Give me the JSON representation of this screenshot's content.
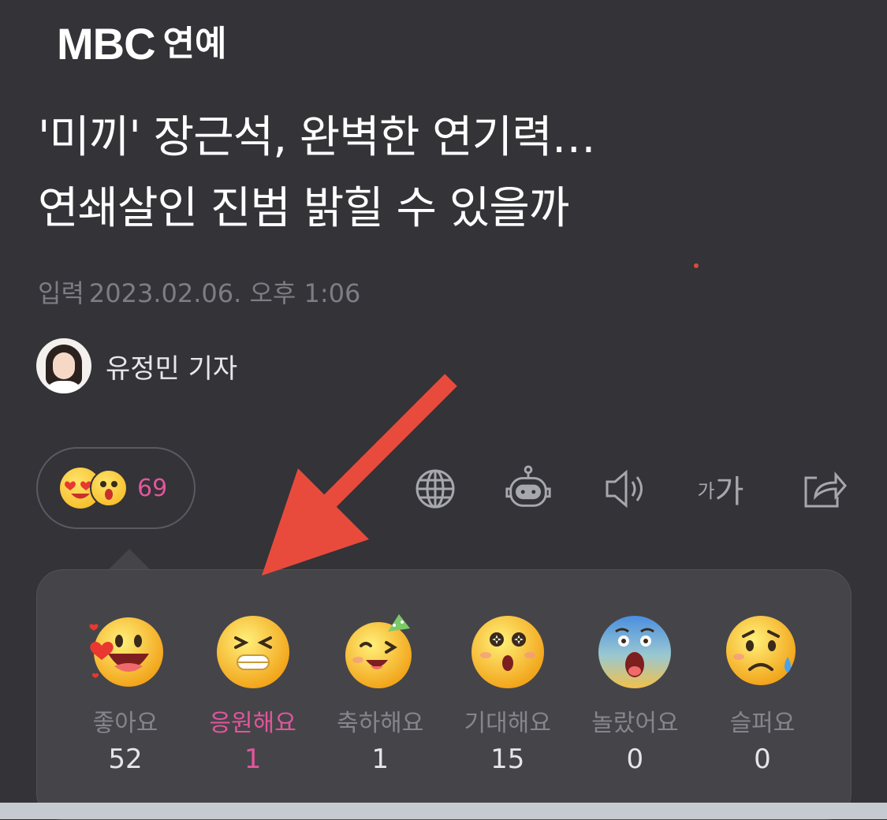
{
  "header": {
    "brand": "MBC",
    "section": "연예"
  },
  "article": {
    "headline_line1": "'미끼' 장근석, 완벽한 연기력…",
    "headline_line2": "연쇄살인 진범 밝힐 수 있을까",
    "date_label": "입력",
    "date_value": "2023.02.06. 오후 1:06",
    "author": "유정민 기자"
  },
  "reaction_summary": {
    "count": "69",
    "icons": [
      "heart-eyes-icon",
      "surprised-icon"
    ]
  },
  "toolbar": {
    "icons": [
      "globe-icon",
      "robot-icon",
      "speaker-icon",
      "font-size-icon",
      "share-icon"
    ],
    "font_small": "가",
    "font_large": "가"
  },
  "reactions": [
    {
      "label": "좋아요",
      "count": "52",
      "icon": "like-emoji-icon"
    },
    {
      "label": "응원해요",
      "count": "1",
      "icon": "cheer-emoji-icon",
      "active": true
    },
    {
      "label": "축하해요",
      "count": "1",
      "icon": "congrats-emoji-icon"
    },
    {
      "label": "기대해요",
      "count": "15",
      "icon": "expect-emoji-icon"
    },
    {
      "label": "놀랐어요",
      "count": "0",
      "icon": "surprised-emoji-icon"
    },
    {
      "label": "슬퍼요",
      "count": "0",
      "icon": "sad-emoji-icon"
    }
  ],
  "colors": {
    "background": "#333338",
    "popup": "#454549",
    "accent_pink": "#e2559c",
    "arrow_red": "#e84b3c"
  }
}
